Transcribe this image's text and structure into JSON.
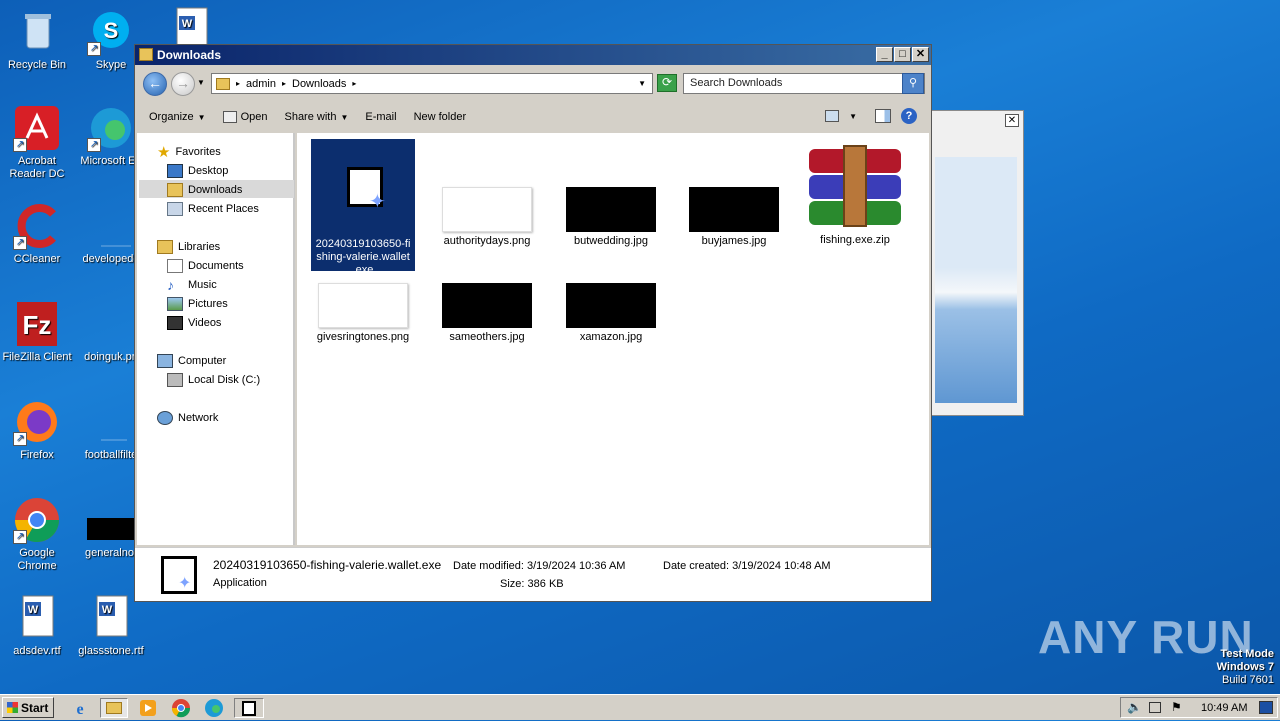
{
  "desktop": {
    "icons": [
      {
        "label": "Recycle Bin"
      },
      {
        "label": "Skype"
      },
      {
        "label": "Acrobat Reader DC"
      },
      {
        "label": "Microsoft Ed"
      },
      {
        "label": "CCleaner"
      },
      {
        "label": "developedd"
      },
      {
        "label": "FileZilla Client"
      },
      {
        "label": "doinguk.pn"
      },
      {
        "label": "Firefox"
      },
      {
        "label": "footballfilte"
      },
      {
        "label": "Google Chrome"
      },
      {
        "label": "generalnot"
      },
      {
        "label": "adsdev.rtf"
      },
      {
        "label": "glassstone.rtf"
      }
    ],
    "watermark": "ANY RUN",
    "test_mode": {
      "line1": "Test Mode",
      "line2": "Windows 7",
      "line3": "Build 7601"
    }
  },
  "window": {
    "title": "Downloads",
    "buttons": {
      "minimize": "_",
      "maximize": "□",
      "close": "✕"
    },
    "address": {
      "crumb1": "admin",
      "crumb2": "Downloads",
      "sep": "▸"
    },
    "search": {
      "placeholder": "Search Downloads"
    },
    "toolbar": {
      "organize": "Organize",
      "open": "Open",
      "share_with": "Share with",
      "email": "E-mail",
      "new_folder": "New folder"
    },
    "nav": {
      "favorites": "Favorites",
      "desktop": "Desktop",
      "downloads": "Downloads",
      "recent_places": "Recent Places",
      "libraries": "Libraries",
      "documents": "Documents",
      "music": "Music",
      "pictures": "Pictures",
      "videos": "Videos",
      "computer": "Computer",
      "local_disk": "Local Disk (C:)",
      "network": "Network"
    },
    "files": [
      {
        "name": "20240319103650-fishing-valerie.wallet.exe",
        "line1": "20240319103650-fi",
        "line2": "shing-valerie.wallet",
        "line3": ".exe"
      },
      {
        "name": "authoritydays.png"
      },
      {
        "name": "butwedding.jpg"
      },
      {
        "name": "buyjames.jpg"
      },
      {
        "name": "fishing.exe.zip"
      },
      {
        "name": "givesringtones.png"
      },
      {
        "name": "sameothers.jpg"
      },
      {
        "name": "xamazon.jpg"
      }
    ],
    "status": {
      "filename": "20240319103650-fishing-valerie.wallet.exe",
      "type": "Application",
      "modified_label": "Date modified:",
      "modified_value": "3/19/2024 10:36 AM",
      "created_label": "Date created:",
      "created_value": "3/19/2024 10:48 AM",
      "size_label": "Size:",
      "size_value": "386 KB"
    }
  },
  "taskbar": {
    "start": "Start",
    "clock": "10:49 AM"
  }
}
